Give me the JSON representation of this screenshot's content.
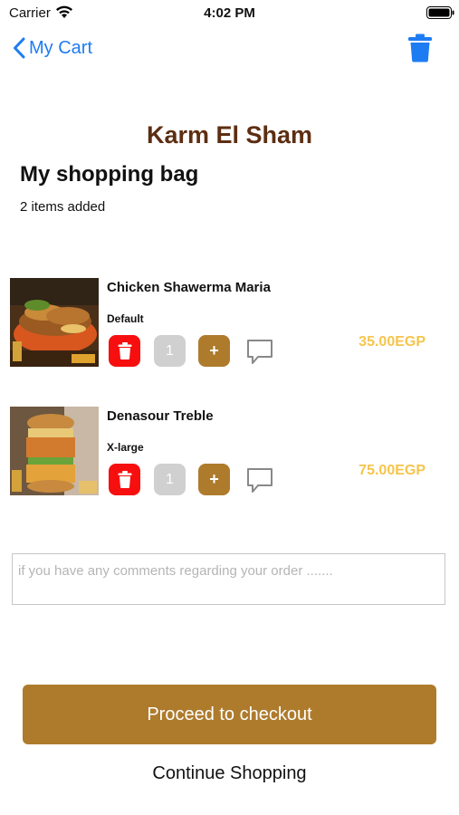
{
  "status_bar": {
    "carrier": "Carrier",
    "time": "4:02 PM"
  },
  "nav": {
    "back_label": "My Cart",
    "accent_color": "#1e7cf2",
    "delete_all_icon": "trash-icon"
  },
  "header": {
    "restaurant_name": "Karm El Sham",
    "title": "My shopping bag",
    "items_count": "2 items added"
  },
  "cart_items": [
    {
      "name": "Chicken Shawerma Maria",
      "size": "Default",
      "quantity": "1",
      "plus_label": "+",
      "price": "35.00EGP"
    },
    {
      "name": "Denasour Treble",
      "size": "X-large",
      "quantity": "1",
      "plus_label": "+",
      "price": "75.00EGP"
    }
  ],
  "comments": {
    "placeholder": "if you have any comments regarding your order ......."
  },
  "actions": {
    "checkout_label": "Proceed to checkout",
    "continue_label": "Continue Shopping"
  },
  "colors": {
    "brand_brown": "#ae7b2d",
    "title_brown": "#5d2e12",
    "price_yellow": "#f5c54d",
    "delete_red": "#f70f0f"
  }
}
